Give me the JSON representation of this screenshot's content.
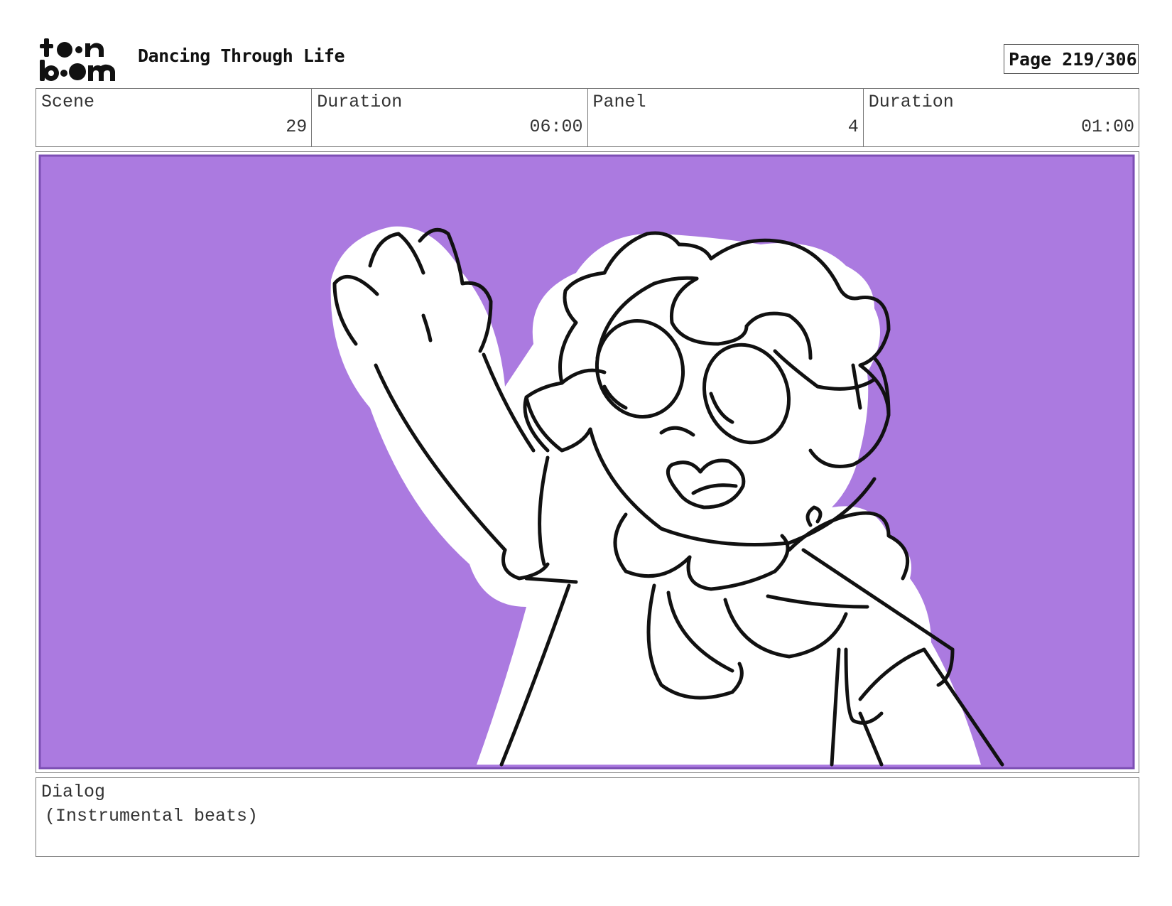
{
  "logo_text": "toon boom",
  "header": {
    "title": "Dancing Through Life",
    "page": "Page 219/306"
  },
  "info": {
    "scene_label": "Scene",
    "scene_value": "29",
    "scene_duration_label": "Duration",
    "scene_duration_value": "06:00",
    "panel_label": "Panel",
    "panel_value": "4",
    "panel_duration_label": "Duration",
    "panel_duration_value": "01:00"
  },
  "panel": {
    "background_color": "#ab7ae0",
    "border_color": "#7c4fb4",
    "line_color": "#111111"
  },
  "dialog": {
    "label": "Dialog",
    "text": "(Instrumental beats)"
  }
}
